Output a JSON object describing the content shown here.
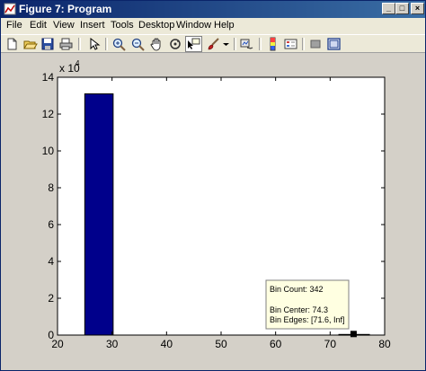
{
  "window": {
    "title": "Figure 7: Program",
    "controls": {
      "minimize": "_",
      "maximize": "□",
      "close": "×"
    }
  },
  "menu": {
    "items": [
      "File",
      "Edit",
      "View",
      "Insert",
      "Tools",
      "Desktop",
      "Window",
      "Help"
    ]
  },
  "toolbar": {
    "icons": [
      "new-figure-icon",
      "open-file-icon",
      "save-icon",
      "print-icon",
      "edit-plot-arrow-icon",
      "zoom-in-icon",
      "zoom-out-icon",
      "pan-hand-icon",
      "rotate-3d-icon",
      "data-cursor-icon",
      "brush-icon",
      "dropdown-arrow-icon",
      "link-plot-icon",
      "colorbar-icon",
      "legend-icon",
      "hide-plot-tools-icon",
      "show-plot-tools-icon"
    ],
    "active": "data-cursor-icon"
  },
  "colors": {
    "bar_fill": "#00008b",
    "datatip_bg": "#ffffe1",
    "title_bar": "#0a246a"
  },
  "chart_data": {
    "type": "bar",
    "x_ticks": [
      "20",
      "30",
      "40",
      "50",
      "60",
      "70",
      "80"
    ],
    "y_ticks": [
      "0",
      "2",
      "4",
      "6",
      "8",
      "10",
      "12",
      "14"
    ],
    "y_multiplier": "x 10",
    "y_exponent": "4",
    "xlim": [
      20,
      80
    ],
    "ylim": [
      0,
      140000
    ],
    "bars": [
      {
        "left": 25,
        "right": 30.2,
        "value": 131000
      },
      {
        "left": 71.6,
        "right": 77.2,
        "value": 342
      }
    ],
    "datatip": {
      "line1": "Bin Count: 342",
      "line2": "Bin Center: 74.3",
      "line3": "Bin Edges: [71.6, Inf]",
      "x": 74.3,
      "y": 342
    },
    "grid": false
  }
}
